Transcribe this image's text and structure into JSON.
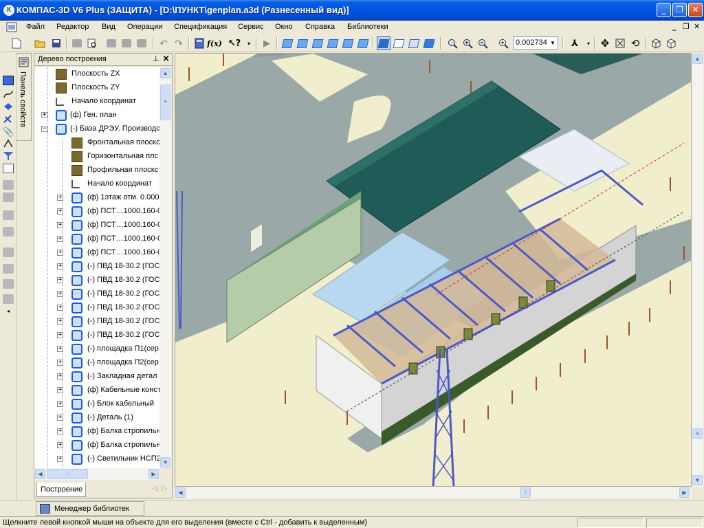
{
  "window": {
    "title": "КОМПАС-3D V6 Plus (ЗАЩИТА) - [D:\\ПУНКТ\\genplan.a3d (Разнесенный вид)]",
    "app_icon_letter": "К"
  },
  "menu": {
    "items": [
      "Файл",
      "Редактор",
      "Вид",
      "Операции",
      "Спецификация",
      "Сервис",
      "Окно",
      "Справка",
      "Библиотеки"
    ]
  },
  "toolbar": {
    "zoom_value": "0.002734"
  },
  "props_panel": {
    "label": "Панель свойств"
  },
  "tree": {
    "title": "Дерево построения",
    "tab_label": "Построение",
    "items": [
      {
        "label": "Плоскость ZX",
        "icon": "plane-icon"
      },
      {
        "label": "Плоскость ZY",
        "icon": "plane-icon"
      },
      {
        "label": "Начало координат",
        "icon": "axis-icon"
      },
      {
        "label": "(ф) Ген. план",
        "icon": "part-icon",
        "expander": "+"
      },
      {
        "label": "(-) База ДРЭУ. Производс",
        "icon": "part-icon",
        "expander": "−"
      },
      {
        "label": "Фронтальная плоскс",
        "icon": "plane-icon"
      },
      {
        "label": "Горизонтальная плс",
        "icon": "plane-icon"
      },
      {
        "label": "Профильная плоскс",
        "icon": "plane-icon"
      },
      {
        "label": "Начало координат",
        "icon": "axis-icon"
      },
      {
        "label": "(ф) 1этаж отм. 0.000",
        "icon": "part-icon",
        "expander": "+"
      },
      {
        "label": "(ф) ПСТ…1000.160-0",
        "icon": "part-icon",
        "expander": "+"
      },
      {
        "label": "(ф) ПСТ…1000.160-0",
        "icon": "part-icon",
        "expander": "+"
      },
      {
        "label": "(ф) ПСТ…1000.160-0",
        "icon": "part-icon",
        "expander": "+"
      },
      {
        "label": "(ф) ПСТ…1000.160-0",
        "icon": "part-icon",
        "expander": "+"
      },
      {
        "label": "(-) ПВД 18-30.2 (ГОС",
        "icon": "part-icon",
        "expander": "+"
      },
      {
        "label": "(-) ПВД 18-30.2 (ГОС",
        "icon": "part-icon",
        "expander": "+"
      },
      {
        "label": "(-) ПВД 18-30.2 (ГОС",
        "icon": "part-icon",
        "expander": "+"
      },
      {
        "label": "(-) ПВД 18-30.2 (ГОС",
        "icon": "part-icon",
        "expander": "+"
      },
      {
        "label": "(-) ПВД 18-30.2 (ГОС",
        "icon": "part-icon",
        "expander": "+"
      },
      {
        "label": "(-) ПВД 18-30.2 (ГОС",
        "icon": "part-icon",
        "expander": "+"
      },
      {
        "label": "(-) площадка П1(сер",
        "icon": "part-icon",
        "expander": "+"
      },
      {
        "label": "(-) площадка П2(сер",
        "icon": "part-icon",
        "expander": "+"
      },
      {
        "label": "(-) Закладная детал",
        "icon": "part-icon",
        "expander": "+"
      },
      {
        "label": "(ф) Кабельные конст",
        "icon": "part-icon",
        "expander": "+"
      },
      {
        "label": "(-) Блок кабельный",
        "icon": "part-icon",
        "expander": "+"
      },
      {
        "label": "(-) Деталь (1)",
        "icon": "part-icon",
        "expander": "+"
      },
      {
        "label": "(ф) Балка стропильн",
        "icon": "part-icon",
        "expander": "+"
      },
      {
        "label": "(ф) Балка стропильн",
        "icon": "part-icon",
        "expander": "+"
      },
      {
        "label": "(-) Светильник НСП2",
        "icon": "part-icon",
        "expander": "+"
      }
    ]
  },
  "library_manager": {
    "label": "Менеджер библиотек"
  },
  "status": {
    "text": "Щелкните левой кнопкой мыши на объекте для его выделения (вместе с Ctrl - добавить к выделенным)"
  },
  "colors": {
    "ground": "#f0eecc",
    "road": "#9aa9a8",
    "roof_green": "#1f5c57",
    "steel_frame": "#4d58c8",
    "titlebar": "#0055e5"
  }
}
